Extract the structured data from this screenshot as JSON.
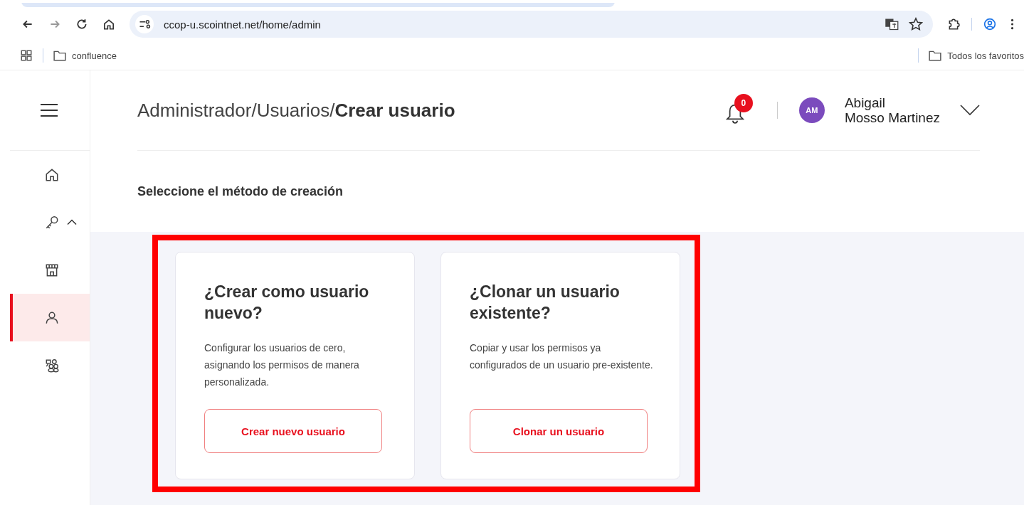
{
  "browser": {
    "url": "ccop-u.scointnet.net/home/admin",
    "bookmarks": [
      "confluence"
    ],
    "all_bookmarks": "Todos los favoritos"
  },
  "sidebar": {
    "items": [
      {
        "selected": false
      },
      {
        "selected": false,
        "expanded": true
      },
      {
        "selected": false
      },
      {
        "selected": true
      },
      {
        "selected": false
      }
    ]
  },
  "header": {
    "breadcrumb": [
      "Administrador/",
      "Usuarios/"
    ],
    "current": "Crear usuario",
    "notifications": "0",
    "user": {
      "initials": "AM",
      "first_name": "Abigail",
      "last_name": "Mosso Martinez"
    }
  },
  "subtitle": "Seleccione el método de creación",
  "cards": [
    {
      "title": "¿Crear como usuario nuevo?",
      "text": "Configurar los usuarios de cero, asignando los permisos de manera personalizada.",
      "button": "Crear nuevo usuario"
    },
    {
      "title": "¿Clonar un usuario existente?",
      "text": "Copiar y usar los permisos ya configurados de un usuario pre-existente.",
      "button": "Clonar un usuario"
    }
  ]
}
